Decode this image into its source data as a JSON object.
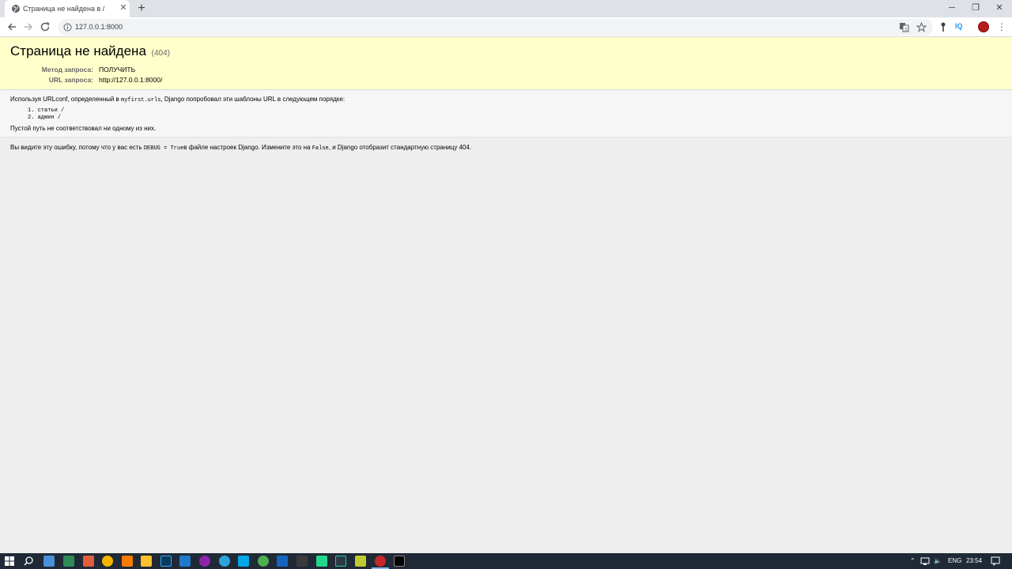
{
  "browser": {
    "tab_title": "Страница не найдена в /",
    "url": "127.0.0.1:8000",
    "iq_label": "IQ"
  },
  "page": {
    "title": "Страница не найдена",
    "status_code": "(404)",
    "request_method_label": "Метод запроса:",
    "request_method_value": "ПОЛУЧИТЬ",
    "request_url_label": "URL запроса:",
    "request_url_value": "http://127.0.0.1:8000/",
    "urlconf_prefix": "Используя URLconf, определенный в ",
    "urlconf_module": "myfirst.urls",
    "urlconf_suffix": ", Django попробовал эти шаблоны URL в следующем порядке:",
    "patterns": [
      "1.  статьи /",
      "2.  админ /"
    ],
    "empty_path_message": "Пустой путь не соответствовал ни одному из них.",
    "debug_prefix": "Вы видите эту ошибку, потому что у вас есть ",
    "debug_code": "DEBUG = True",
    "debug_middle": "в файле настроек Django. Измените это на ",
    "false_code": "False",
    "debug_suffix": ", и Django отобразит стандартную страницу 404."
  },
  "taskbar": {
    "language": "ENG",
    "time": "23:54"
  },
  "colors": {
    "summary_bg": "#ffffcc",
    "page_bg": "#eeeeee",
    "taskbar_bg": "#1f2a36"
  }
}
